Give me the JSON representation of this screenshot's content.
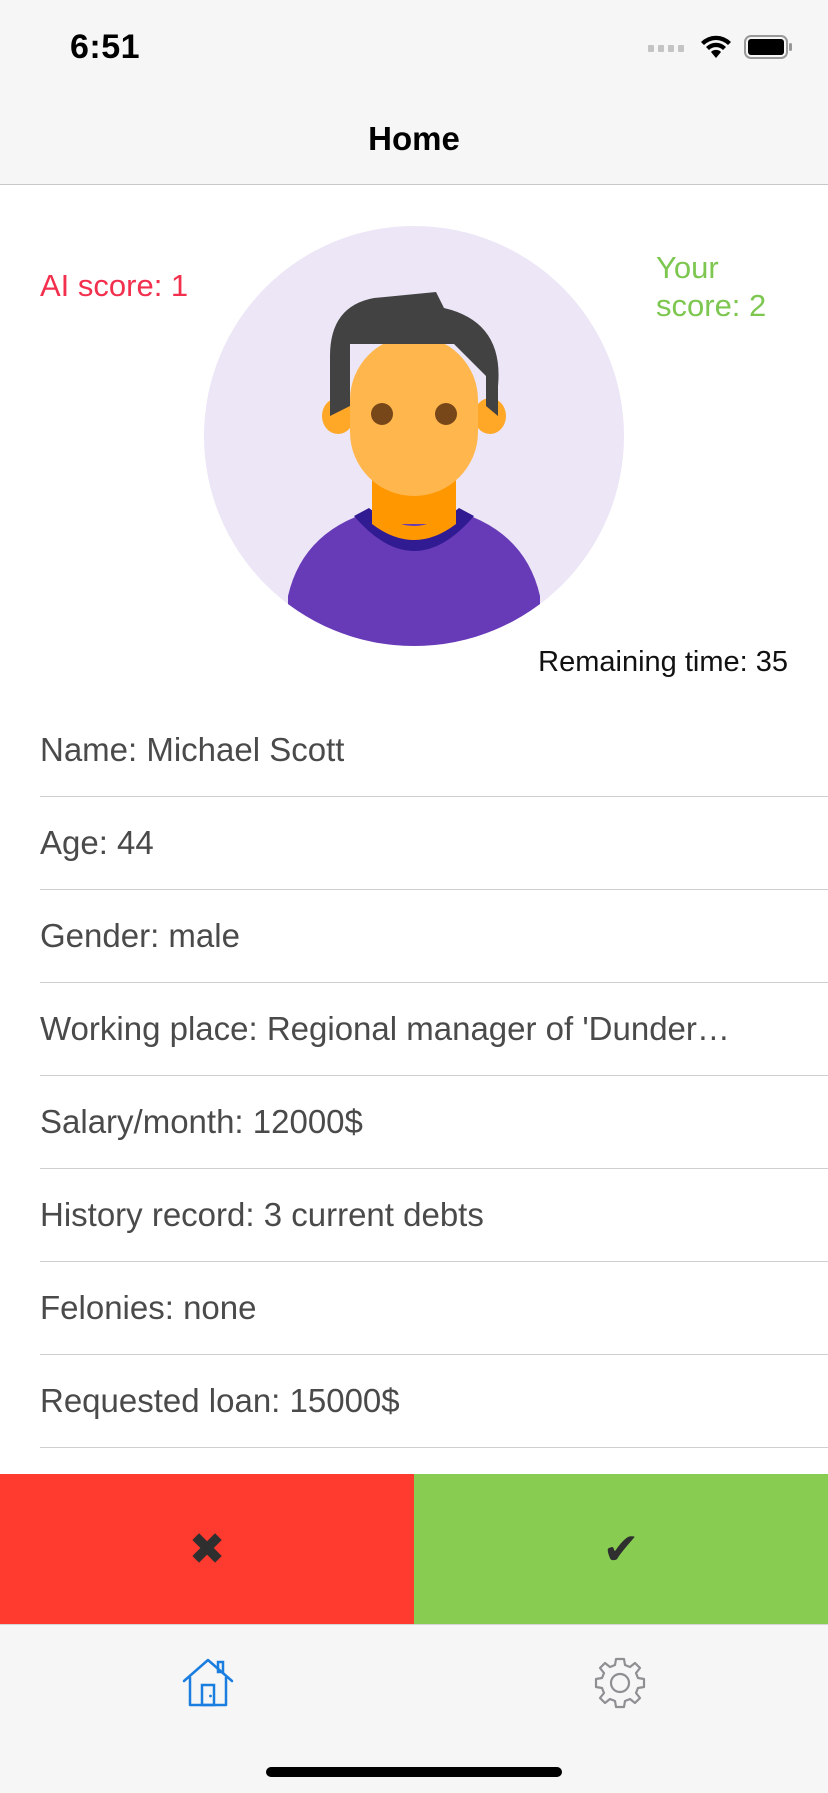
{
  "status_bar": {
    "time": "6:51",
    "icons": [
      "cellular-signal-icon",
      "wifi-icon",
      "battery-icon"
    ]
  },
  "nav": {
    "title": "Home"
  },
  "scores": {
    "ai_label": "AI score: 1",
    "ai_color": "#f2304e",
    "user_label": "Your score: 2",
    "user_color": "#7dc750"
  },
  "avatar": {
    "icon": "person-avatar-icon"
  },
  "timer": {
    "text": "Remaining time: 35"
  },
  "applicant": {
    "rows": [
      "Name: Michael Scott",
      "Age: 44",
      "Gender: male",
      "Working place: Regional manager of 'Dunder…",
      "Salary/month: 12000$",
      "History record: 3 current debts",
      "Felonies: none",
      "Requested loan: 15000$"
    ]
  },
  "actions": {
    "reject_glyph": "✖",
    "reject_color": "#ff3a2f",
    "approve_glyph": "✔",
    "approve_color": "#88cd52"
  },
  "tab_bar": {
    "items": [
      {
        "icon": "home-icon",
        "active_color": "#1a7ee0"
      },
      {
        "icon": "gear-icon",
        "color": "#8e8e93"
      }
    ]
  }
}
